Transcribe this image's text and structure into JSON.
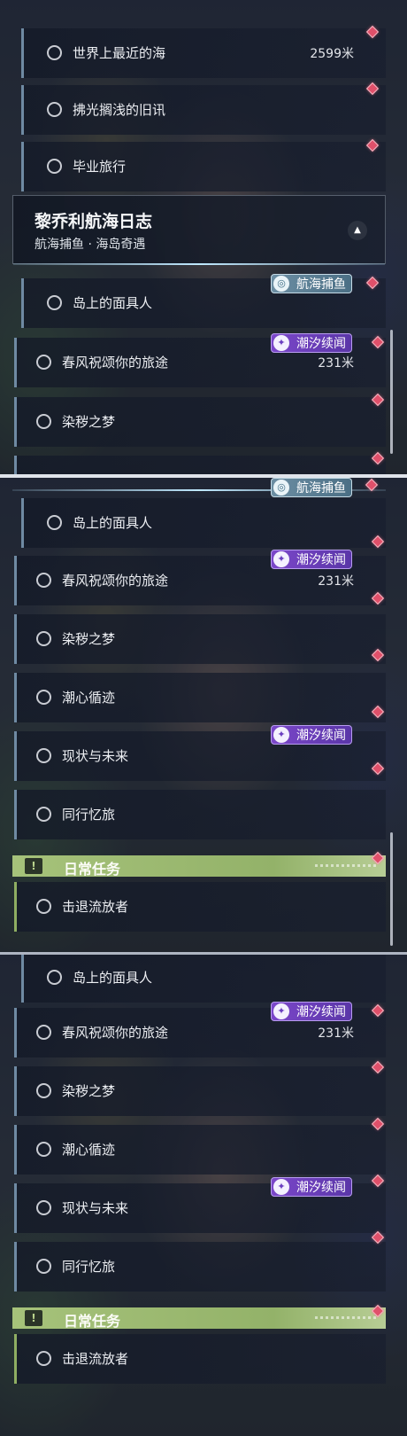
{
  "badges": {
    "tide": "潮汐续闻",
    "fish": "航海捕鱼"
  },
  "chapter": {
    "title": "黎乔利航海日志",
    "subtitle": "航海捕鱼 · 海岛奇遇",
    "collapse_icon": "chevron-up-icon"
  },
  "daily_section": {
    "label": "日常任务",
    "icon": "exclamation-icon",
    "color": "#a6c27a"
  },
  "panel1": {
    "quests_top": [
      {
        "label": "世界上最近的海",
        "distance": "2599米"
      },
      {
        "label": "拂光搁浅的旧讯",
        "distance": ""
      },
      {
        "label": "毕业旅行",
        "distance": ""
      }
    ],
    "quests_bottom": [
      {
        "label": "岛上的面具人",
        "distance": ""
      },
      {
        "label": "春风祝颂你的旅途",
        "distance": "231米"
      },
      {
        "label": "染秽之梦",
        "distance": ""
      }
    ]
  },
  "panel2": {
    "quests": [
      {
        "label": "岛上的面具人",
        "distance": ""
      },
      {
        "label": "春风祝颂你的旅途",
        "distance": "231米"
      },
      {
        "label": "染秽之梦",
        "distance": ""
      },
      {
        "label": "潮心循迹",
        "distance": ""
      },
      {
        "label": "现状与未来",
        "distance": ""
      },
      {
        "label": "同行忆旅",
        "distance": ""
      }
    ],
    "daily": [
      {
        "label": "击退流放者",
        "distance": ""
      }
    ]
  },
  "panel3": {
    "quests": [
      {
        "label": "岛上的面具人",
        "distance": ""
      },
      {
        "label": "春风祝颂你的旅途",
        "distance": "231米"
      },
      {
        "label": "染秽之梦",
        "distance": ""
      },
      {
        "label": "潮心循迹",
        "distance": ""
      },
      {
        "label": "现状与未来",
        "distance": ""
      },
      {
        "label": "同行忆旅",
        "distance": ""
      }
    ],
    "daily": [
      {
        "label": "击退流放者",
        "distance": ""
      }
    ]
  },
  "colors": {
    "marker": "#e0506a",
    "tide_badge": "#7b47c9",
    "fish_badge": "#6c8ea3"
  }
}
